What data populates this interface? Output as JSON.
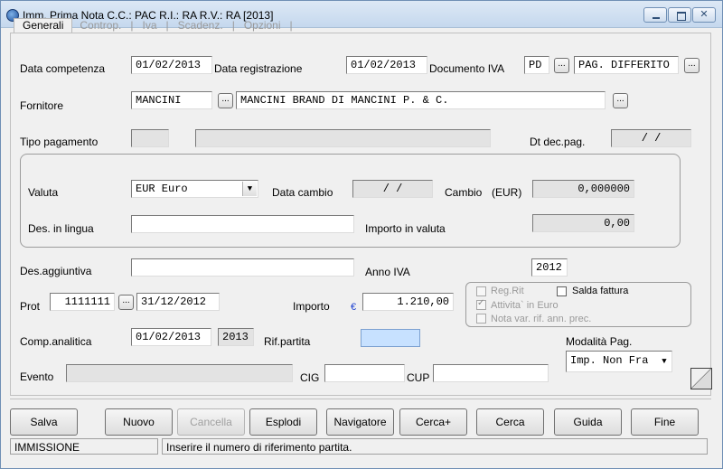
{
  "window": {
    "title": "Imm. Prima Nota C.C.: PAC  R.I.: RA  R.V.: RA  [2013]"
  },
  "tabs": [
    {
      "label": "Generali"
    },
    {
      "label": "Controp."
    },
    {
      "label": "Iva"
    },
    {
      "label": "Scadenz."
    },
    {
      "label": "Opzioni"
    }
  ],
  "tab_separator": "|",
  "form": {
    "data_competenza": {
      "label": "Data competenza",
      "value": "01/02/2013"
    },
    "data_registrazione": {
      "label": "Data registrazione",
      "value": "01/02/2013"
    },
    "documento_iva": {
      "label": "Documento IVA",
      "code": "PD",
      "desc": "PAG. DIFFERITO"
    },
    "fornitore": {
      "label": "Fornitore",
      "code": "MANCINI",
      "name": "MANCINI BRAND DI MANCINI P. & C."
    },
    "tipo_pagamento": {
      "label": "Tipo pagamento",
      "code": "",
      "desc": ""
    },
    "dt_dec_pag": {
      "label": "Dt dec.pag.",
      "value": "/  /"
    },
    "valuta": {
      "label": "Valuta",
      "value": "EUR Euro"
    },
    "data_cambio": {
      "label": "Data cambio",
      "value": "/  /"
    },
    "cambio": {
      "label": "Cambio",
      "unit": "(EUR)",
      "value": "0,000000"
    },
    "des_lingua": {
      "label": "Des. in lingua",
      "value": ""
    },
    "importo_valuta": {
      "label": "Importo in valuta",
      "value": "0,00"
    },
    "des_aggiuntiva": {
      "label": "Des.aggiuntiva",
      "value": ""
    },
    "anno_iva": {
      "label": "Anno IVA",
      "value": "2012"
    },
    "prot": {
      "label": "Prot",
      "number": "1111111",
      "date": "31/12/2012"
    },
    "importo": {
      "label": "Importo",
      "currency_symbol": "€",
      "value": "1.210,00"
    },
    "comp_analitica": {
      "label": "Comp.analitica",
      "date": "01/02/2013",
      "year": "2013"
    },
    "rif_partita": {
      "label": "Rif.partita",
      "value": ""
    },
    "evento": {
      "label": "Evento",
      "value": ""
    },
    "cig": {
      "label": "CIG",
      "value": ""
    },
    "cup": {
      "label": "CUP",
      "value": ""
    },
    "modalita_pag": {
      "label": "Modalità Pag.",
      "value": "Imp. Non Fra"
    }
  },
  "checkboxes": {
    "reg_rit": {
      "label": "Reg.Rit",
      "checked": false
    },
    "salda_fattura": {
      "label": "Salda fattura",
      "checked": false
    },
    "attivita_euro": {
      "label": "Attivita` in Euro",
      "checked": true
    },
    "nota_var": {
      "label": "Nota var. rif. ann. prec.",
      "checked": false
    }
  },
  "buttons": {
    "salva": "Salva",
    "nuovo": "Nuovo",
    "cancella": "Cancella",
    "esplodi": "Esplodi",
    "navigatore": "Navigatore",
    "cerca_plus": "Cerca+",
    "cerca": "Cerca",
    "guida": "Guida",
    "fine": "Fine"
  },
  "dots_label": "...",
  "status": {
    "mode": "IMMISSIONE",
    "message": "Inserire il numero di riferimento partita."
  }
}
